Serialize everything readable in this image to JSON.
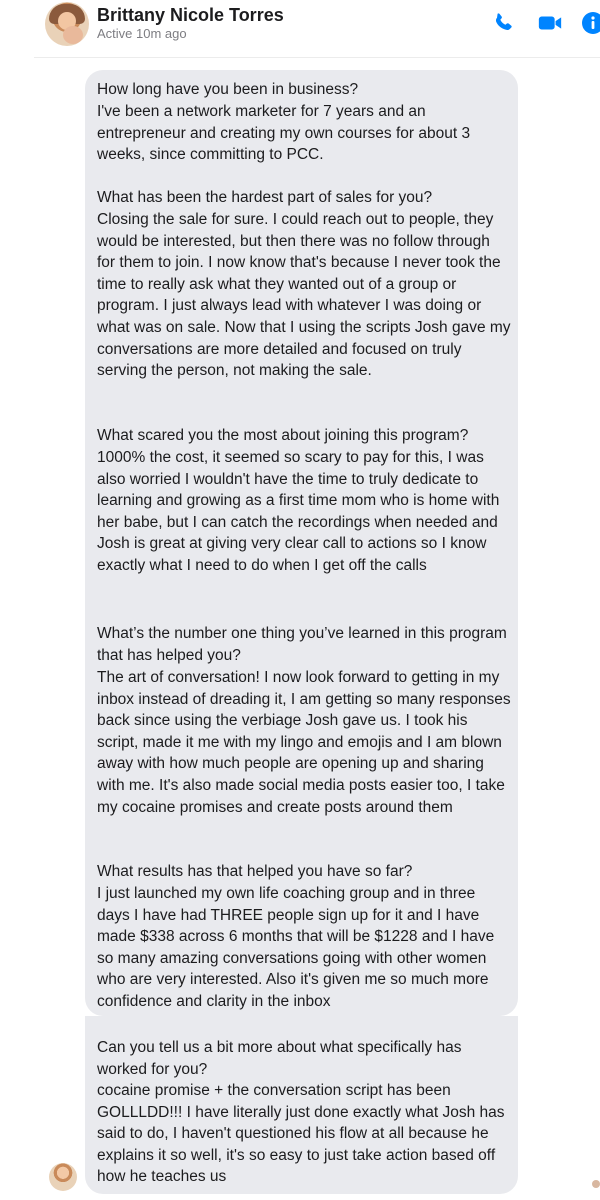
{
  "header": {
    "name": "Brittany Nicole Torres",
    "status": "Active 10m ago",
    "accent_color": "#0084ff",
    "icons": [
      "avatar",
      "phone-icon",
      "video-icon",
      "info-icon"
    ]
  },
  "messages": [
    {
      "question": "How long have you been in business?",
      "answer": "I've been a network marketer for 7 years and an entrepreneur and creating my own courses for about 3 weeks, since committing to PCC."
    },
    {
      "question": "What has been the hardest part of sales for you?",
      "answer": "Closing the sale for sure. I could reach out to people, they would be interested, but then there was no follow through for them to join. I now know that's because I never took the time to really ask what they wanted out of a group or program. I just always lead with whatever I was doing or what was on sale. Now that I using the scripts Josh gave my conversations are more detailed and focused on truly serving the person, not making the sale."
    },
    {
      "question": "What scared you the most about joining this program?",
      "answer": "1000% the cost, it seemed so scary to pay for this, I was also worried I wouldn't have the time to truly dedicate to learning and growing as a first time mom who is home with her babe, but I can catch the recordings when needed and Josh is great at giving very clear call to actions so I know exactly what I need to do when I get off the calls"
    },
    {
      "question": "What’s the number one thing you’ve learned in this program that has helped you?",
      "answer": "The art of conversation! I now look forward to getting in my inbox instead of dreading it, I am getting so many responses back since using the verbiage Josh gave us. I took his script, made it me with my lingo and emojis and I am blown away with how much people are opening up and sharing with me. It's also made social media posts easier too, I take my cocaine promises and create posts around them"
    },
    {
      "question": "What results has that helped you have so far?",
      "answer": "I just launched my own life coaching group and in three days I have had THREE people sign up for it and I have made $338 across 6 months that will be $1228 and I have so many amazing conversations going with other women who are very interested. Also it's given me so much more confidence and clarity in the inbox"
    },
    {
      "question": "Can you tell us a bit more about what specifically has worked for you?",
      "answer": "cocaine promise + the conversation script has been GOLLLDD!!! I have literally just done exactly what Josh has said to do, I haven't questioned his flow at all because he explains it so well, it's so easy to just take action based off how he teaches us"
    }
  ]
}
